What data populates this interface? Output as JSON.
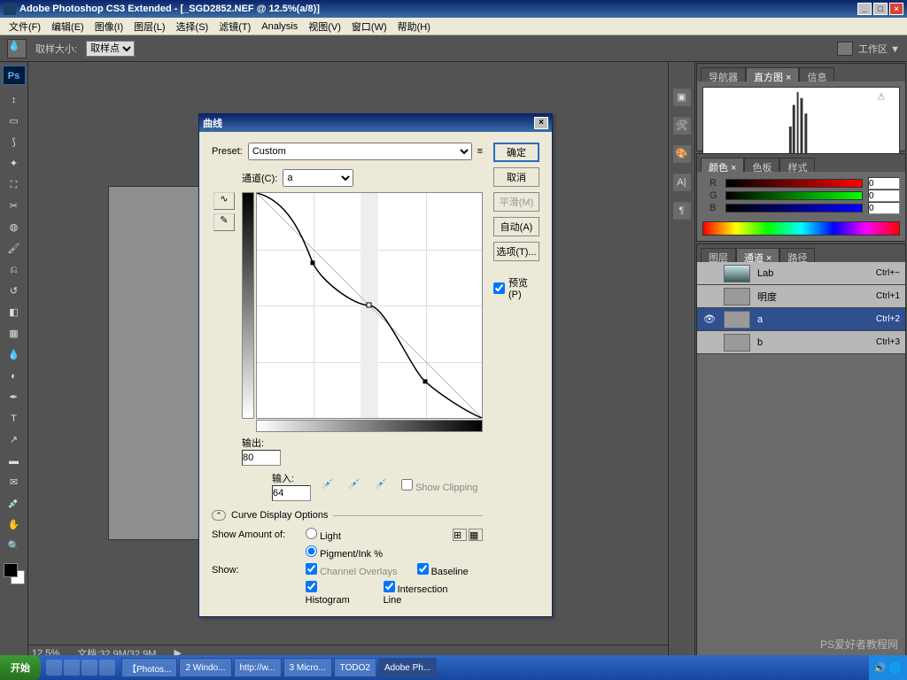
{
  "title": "Adobe Photoshop CS3 Extended - [_SGD2852.NEF @ 12.5%(a/8)]",
  "menu": [
    "文件(F)",
    "编辑(E)",
    "图像(I)",
    "图层(L)",
    "选择(S)",
    "滤镜(T)",
    "Analysis",
    "视图(V)",
    "窗口(W)",
    "帮助(H)"
  ],
  "optbar": {
    "sample_label": "取样大小:",
    "sample_value": "取样点",
    "workarea": "工作区 ▼"
  },
  "status": {
    "zoom": "12.5%",
    "doc": "文档:32.9M/32.9M"
  },
  "panels": {
    "nav_tabs": [
      "导航器",
      "直方图 ×",
      "信息"
    ],
    "color_tabs": [
      "颜色 ×",
      "色板",
      "样式"
    ],
    "color": {
      "r": "0",
      "g": "0",
      "b": "0"
    },
    "layer_tabs": [
      "图层",
      "通道 ×",
      "路径"
    ],
    "channels": [
      {
        "name": "Lab",
        "sc": "Ctrl+~",
        "sel": false,
        "eye": false,
        "thumb": "lab"
      },
      {
        "name": "明度",
        "sc": "Ctrl+1",
        "sel": false,
        "eye": false,
        "thumb": "g"
      },
      {
        "name": "a",
        "sc": "Ctrl+2",
        "sel": true,
        "eye": true,
        "thumb": "g"
      },
      {
        "name": "b",
        "sc": "Ctrl+3",
        "sel": false,
        "eye": false,
        "thumb": "g"
      }
    ]
  },
  "dialog": {
    "title": "曲线",
    "preset_label": "Preset:",
    "preset_value": "Custom",
    "channel_label": "通道(C):",
    "channel_value": "a",
    "output_label": "输出:",
    "output_value": "80",
    "input_label": "输入:",
    "input_value": "64",
    "show_clipping": "Show Clipping",
    "cdo": "Curve Display Options",
    "show_amount": "Show Amount of:",
    "light": "Light",
    "pigment": "Pigment/Ink %",
    "show": "Show:",
    "chov": "Channel Overlays",
    "baseline": "Baseline",
    "histogram": "Histogram",
    "intersection": "Intersection Line",
    "ok": "确定",
    "cancel": "取消",
    "smooth": "平滑(M)",
    "auto": "自动(A)",
    "options": "选项(T)...",
    "preview": "预览(P)"
  },
  "chart_data": {
    "type": "line",
    "title": "曲线 (a channel)",
    "xlabel": "输入",
    "ylabel": "输出",
    "x": [
      0,
      64,
      128,
      192,
      255
    ],
    "values": [
      0,
      80,
      128,
      215,
      255
    ],
    "xlim": [
      0,
      255
    ],
    "ylim": [
      0,
      255
    ]
  },
  "taskbar": {
    "start": "开始",
    "tasks": [
      "【Photos...",
      "2 Windo...",
      "http://w...",
      "3 Micro...",
      "TODO2",
      "Adobe Ph..."
    ],
    "watermark": "PS爱好者教程网"
  }
}
